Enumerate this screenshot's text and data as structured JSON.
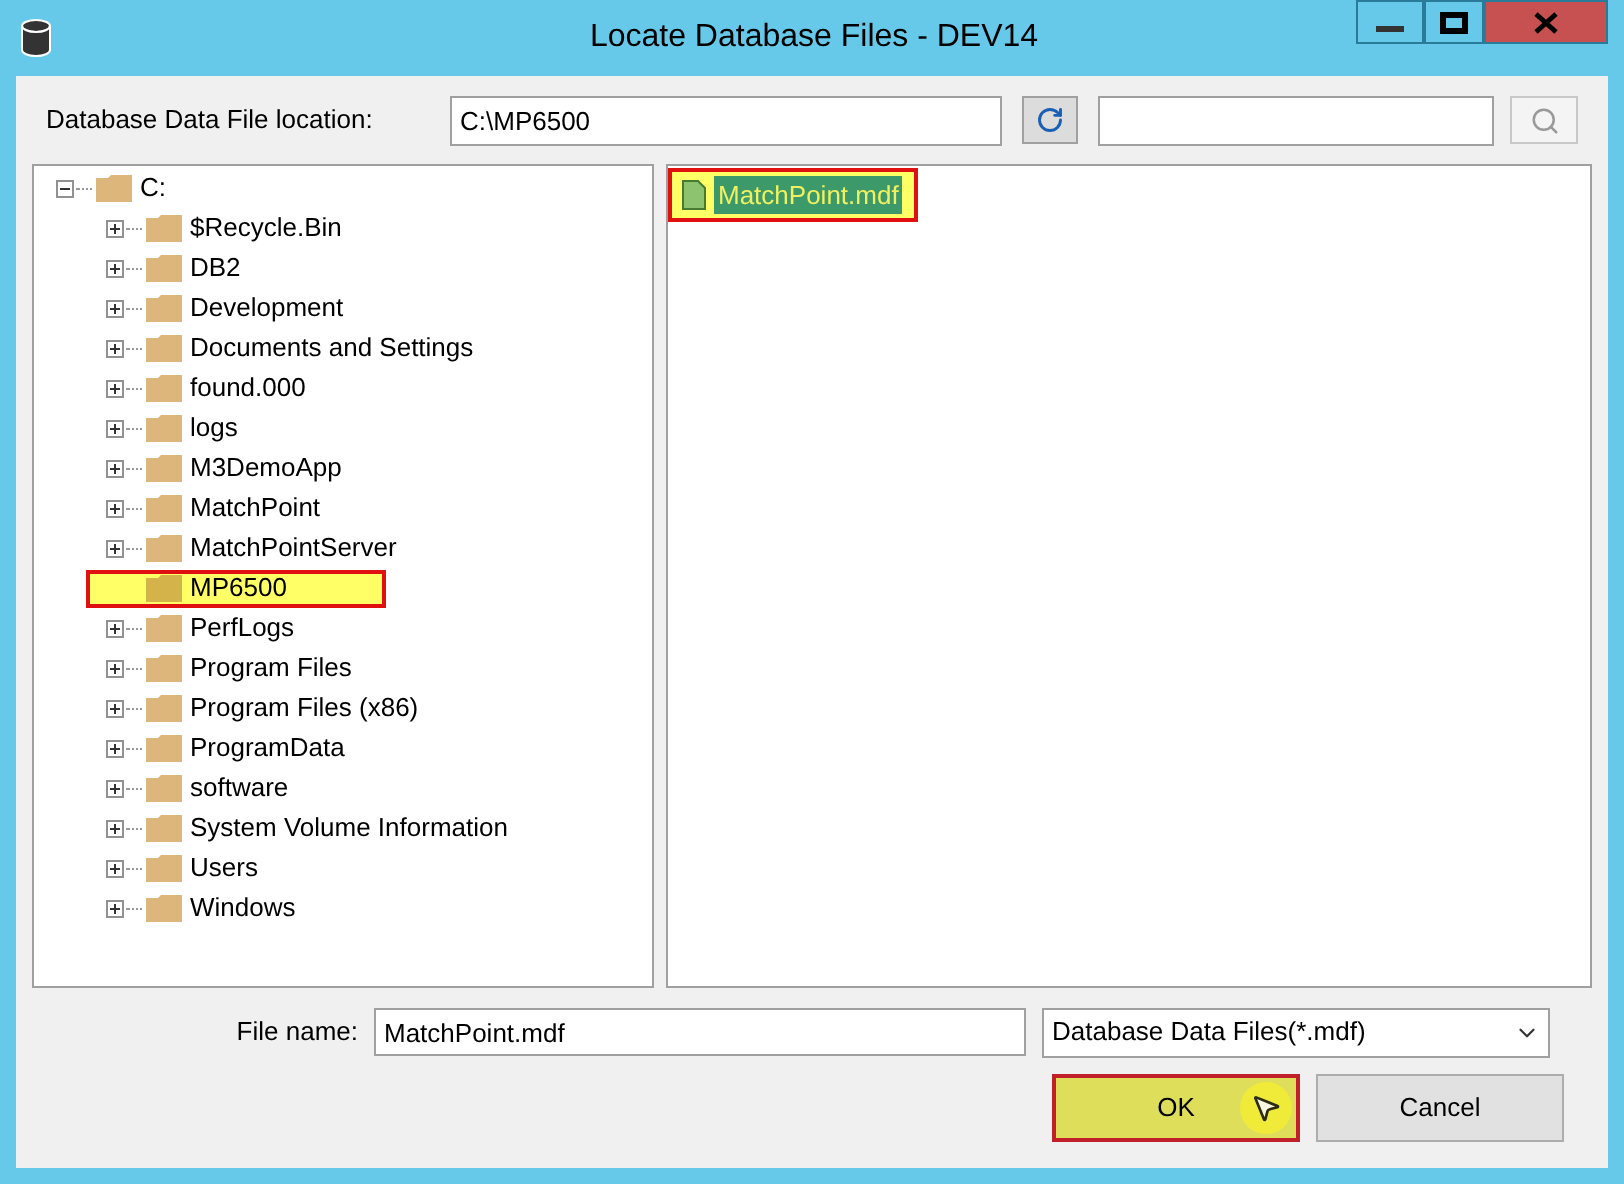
{
  "window": {
    "title": "Locate Database Files - DEV14"
  },
  "location": {
    "label": "Database Data File location:",
    "value": "C:\\MP6500"
  },
  "tree": {
    "label": "C:",
    "expanded": true,
    "selected": false,
    "children": [
      {
        "label": "$Recycle.Bin",
        "expandable": true,
        "selected": false
      },
      {
        "label": "DB2",
        "expandable": true,
        "selected": false
      },
      {
        "label": "Development",
        "expandable": true,
        "selected": false
      },
      {
        "label": "Documents and Settings",
        "expandable": true,
        "selected": false
      },
      {
        "label": "found.000",
        "expandable": true,
        "selected": false
      },
      {
        "label": "logs",
        "expandable": true,
        "selected": false
      },
      {
        "label": "M3DemoApp",
        "expandable": true,
        "selected": false
      },
      {
        "label": "MatchPoint",
        "expandable": true,
        "selected": false
      },
      {
        "label": "MatchPointServer",
        "expandable": true,
        "selected": false
      },
      {
        "label": "MP6500",
        "expandable": false,
        "selected": true
      },
      {
        "label": "PerfLogs",
        "expandable": true,
        "selected": false
      },
      {
        "label": "Program Files",
        "expandable": true,
        "selected": false
      },
      {
        "label": "Program Files (x86)",
        "expandable": true,
        "selected": false
      },
      {
        "label": "ProgramData",
        "expandable": true,
        "selected": false
      },
      {
        "label": "software",
        "expandable": true,
        "selected": false
      },
      {
        "label": "System Volume Information",
        "expandable": true,
        "selected": false
      },
      {
        "label": "Users",
        "expandable": true,
        "selected": false
      },
      {
        "label": "Windows",
        "expandable": true,
        "selected": false
      }
    ]
  },
  "files": [
    {
      "name": "MatchPoint.mdf",
      "selected": true
    }
  ],
  "file_name": {
    "label": "File name:",
    "value": "MatchPoint.mdf"
  },
  "file_type": {
    "value": "Database Data Files(*.mdf)"
  },
  "buttons": [
    {
      "label": "OK",
      "kind": "primary"
    },
    {
      "label": "Cancel",
      "kind": "normal"
    }
  ]
}
